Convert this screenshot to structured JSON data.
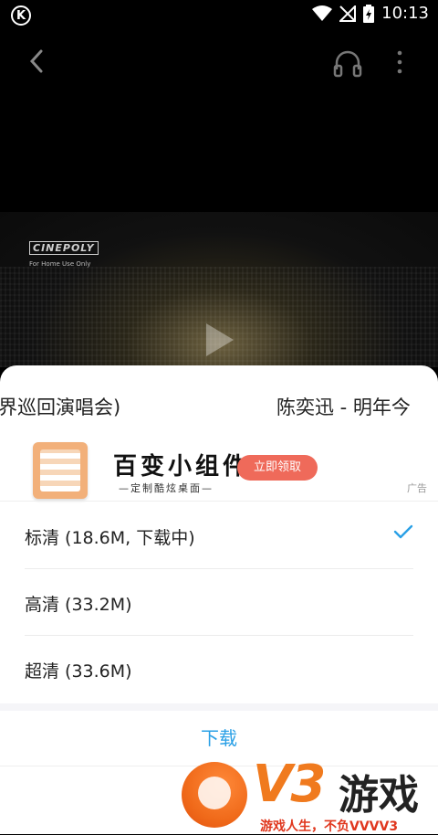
{
  "status_bar": {
    "logo_letter": "K",
    "time": "10:13"
  },
  "video": {
    "watermark_brand": "CINEPOLY",
    "watermark_sub": "For Home Use Only"
  },
  "sheet": {
    "title_part_a": "界巡回演唱会)",
    "title_part_b": "陈奕迅 - 明年今日",
    "ad": {
      "title": "百变小组件",
      "subtitle": "—定制酷炫桌面—",
      "button": "立即领取",
      "tag": "广告"
    },
    "options": [
      {
        "label": "标清 (18.6M, 下载中)",
        "selected": true
      },
      {
        "label": "高清 (33.2M)",
        "selected": false
      },
      {
        "label": "超清 (33.6M)",
        "selected": false
      }
    ],
    "download_label": "下载"
  },
  "watermark_v3": {
    "logo": "V3",
    "name": "游戏",
    "slogan": "游戏人生，不负VVVV3"
  },
  "colors": {
    "accent": "#2aa0e6",
    "ad_button": "#ef6a5a",
    "v3_orange": "#f07a1e"
  }
}
